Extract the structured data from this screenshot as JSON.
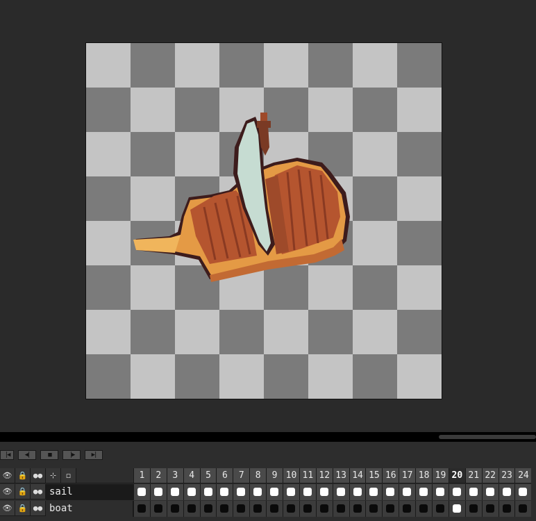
{
  "canvas": {
    "sprite_name": "sailboat sprite",
    "colors": {
      "hull_light": "#e49a45",
      "hull_dark": "#9e4a2a",
      "deck_plank": "#b5552f",
      "outline": "#3d1c1c",
      "sail": "#c6dcd2",
      "mast": "#7a3a24"
    }
  },
  "playback": {
    "buttons": [
      {
        "name": "first-frame-icon",
        "glyph": "|◀"
      },
      {
        "name": "previous-frame-icon",
        "glyph": "◀|"
      },
      {
        "name": "play-icon",
        "glyph": "■"
      },
      {
        "name": "next-frame-icon",
        "glyph": "|▶"
      },
      {
        "name": "last-frame-icon",
        "glyph": "▶|"
      }
    ]
  },
  "timeline": {
    "header_icons": [
      {
        "name": "visibility-icon",
        "glyph": "👁"
      },
      {
        "name": "lock-icon",
        "glyph": "🔒"
      },
      {
        "name": "continuous-icon",
        "glyph": "●●"
      },
      {
        "name": "link-cels-icon",
        "glyph": "⊹"
      },
      {
        "name": "layer-options-icon",
        "glyph": "◻"
      }
    ],
    "frames": [
      "1",
      "2",
      "3",
      "4",
      "5",
      "6",
      "7",
      "8",
      "9",
      "10",
      "11",
      "12",
      "13",
      "14",
      "15",
      "16",
      "17",
      "18",
      "19",
      "20",
      "21",
      "22",
      "23",
      "24"
    ],
    "current_frame": "20",
    "layers": [
      {
        "name": "sail",
        "eye": "👁",
        "lock": "🔒",
        "continuous": "●●"
      },
      {
        "name": "boat",
        "eye": "👁",
        "lock": "🔒",
        "continuous": "●●"
      }
    ]
  }
}
